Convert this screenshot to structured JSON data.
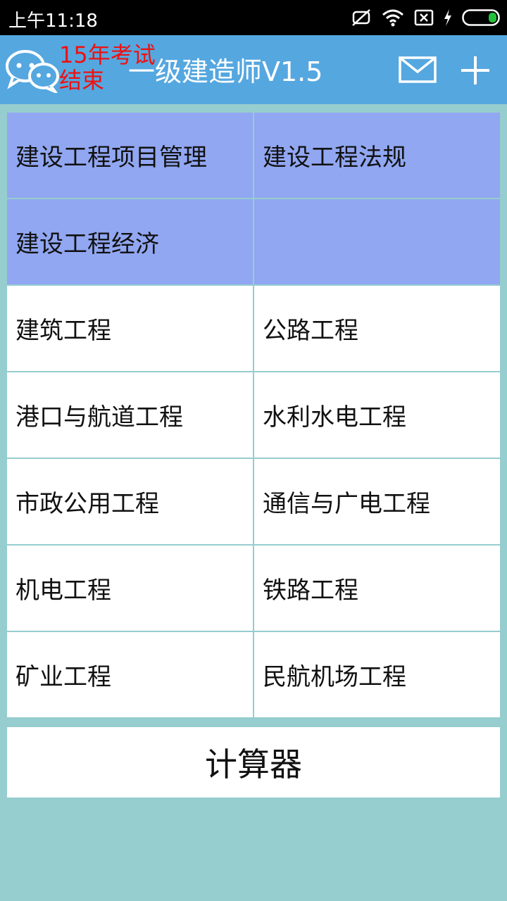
{
  "status_bar": {
    "time": "上午11:18",
    "icons": [
      "mute-icon",
      "wifi-icon",
      "sim-off-icon",
      "charging-icon",
      "battery-icon"
    ],
    "battery_color": "#23c13b"
  },
  "app_bar": {
    "notice": "15年考试结束",
    "title": "一级建造师V1.5",
    "background": "#55a7e0",
    "notice_color": "#ee1111",
    "icons": [
      "chat-icon",
      "mail-icon",
      "plus-icon"
    ]
  },
  "subjects": [
    {
      "label": "建设工程项目管理",
      "highlight": true
    },
    {
      "label": "建设工程法规",
      "highlight": true
    },
    {
      "label": "建设工程经济",
      "highlight": true
    },
    {
      "label": "",
      "highlight": true
    },
    {
      "label": "建筑工程",
      "highlight": false
    },
    {
      "label": "公路工程",
      "highlight": false
    },
    {
      "label": "港口与航道工程",
      "highlight": false
    },
    {
      "label": "水利水电工程",
      "highlight": false
    },
    {
      "label": "市政公用工程",
      "highlight": false
    },
    {
      "label": "通信与广电工程",
      "highlight": false
    },
    {
      "label": "机电工程",
      "highlight": false
    },
    {
      "label": "铁路工程",
      "highlight": false
    },
    {
      "label": "矿业工程",
      "highlight": false
    },
    {
      "label": "民航机场工程",
      "highlight": false
    }
  ],
  "calculator": {
    "label": "计算器"
  },
  "colors": {
    "background": "#96cdce",
    "highlight": "#91a7f2"
  }
}
